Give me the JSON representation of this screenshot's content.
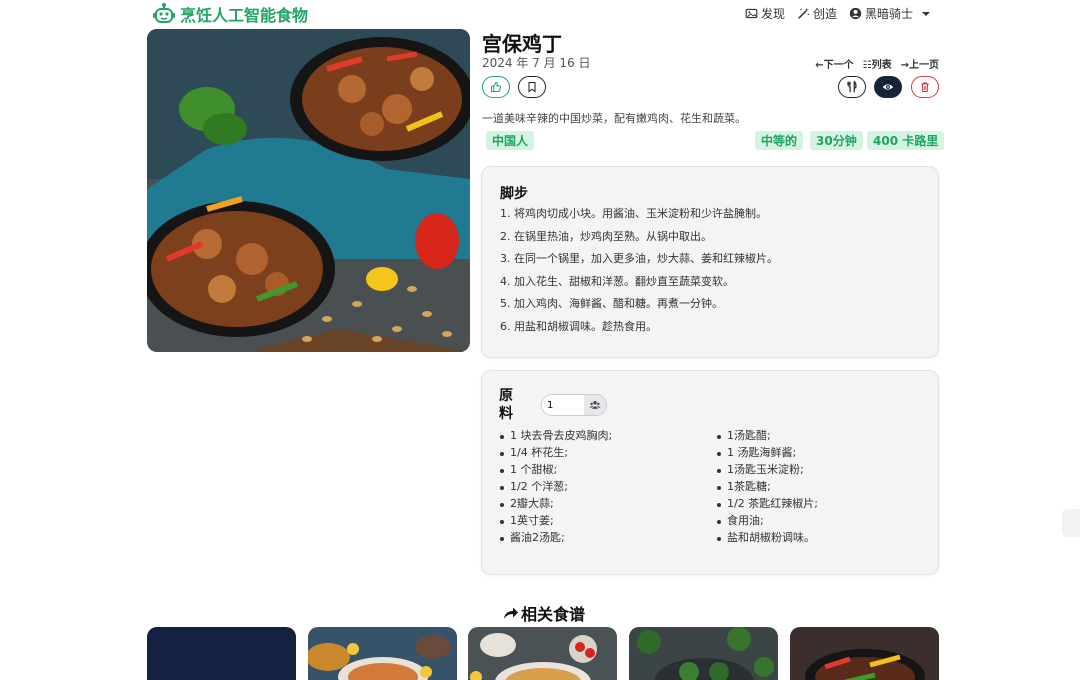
{
  "brand": {
    "name": "烹饪人工智能食物"
  },
  "nav": {
    "discover": "发现",
    "create": "创造",
    "user": "黑暗骑士"
  },
  "recipe": {
    "title": "宫保鸡丁",
    "date": "2024 年 7 月 16 日",
    "description": "一道美味辛辣的中国炒菜，配有嫩鸡肉、花生和蔬菜。",
    "tags": {
      "cuisine": "中国人",
      "difficulty": "中等的",
      "time": "30分钟",
      "calories": "400 卡路里"
    }
  },
  "pager": {
    "next": "←下一个",
    "list": "列表",
    "prev": "→上一页"
  },
  "steps": {
    "title": "脚步",
    "items": [
      "1. 将鸡肉切成小块。用酱油、玉米淀粉和少许盐腌制。",
      "2. 在锅里热油，炒鸡肉至熟。从锅中取出。",
      "3. 在同一个锅里，加入更多油，炒大蒜、姜和红辣椒片。",
      "4. 加入花生、甜椒和洋葱。翻炒直至蔬菜变软。",
      "5. 加入鸡肉、海鲜酱、醋和糖。再煮一分钟。",
      "6. 用盐和胡椒调味。趁热食用。"
    ]
  },
  "ingredients": {
    "title": "原料",
    "servings_value": "1",
    "left": [
      "1 块去骨去皮鸡胸肉;",
      "1/4 杯花生;",
      "1 个甜椒;",
      "1/2 个洋葱;",
      "2瓣大蒜;",
      "1英寸姜;",
      "酱油2汤匙;"
    ],
    "right": [
      "1汤匙醋;",
      "1 汤匙海鲜酱;",
      "1汤匙玉米淀粉;",
      "1茶匙糖;",
      "1/2 茶匙红辣椒片;",
      "食用油;",
      "盐和胡椒粉调味。"
    ]
  },
  "related": {
    "title": "相关食谱"
  },
  "colors": {
    "brand": "#20a464",
    "danger": "#dc3545",
    "dark": "#14233a",
    "card": "#f3f4f6"
  }
}
